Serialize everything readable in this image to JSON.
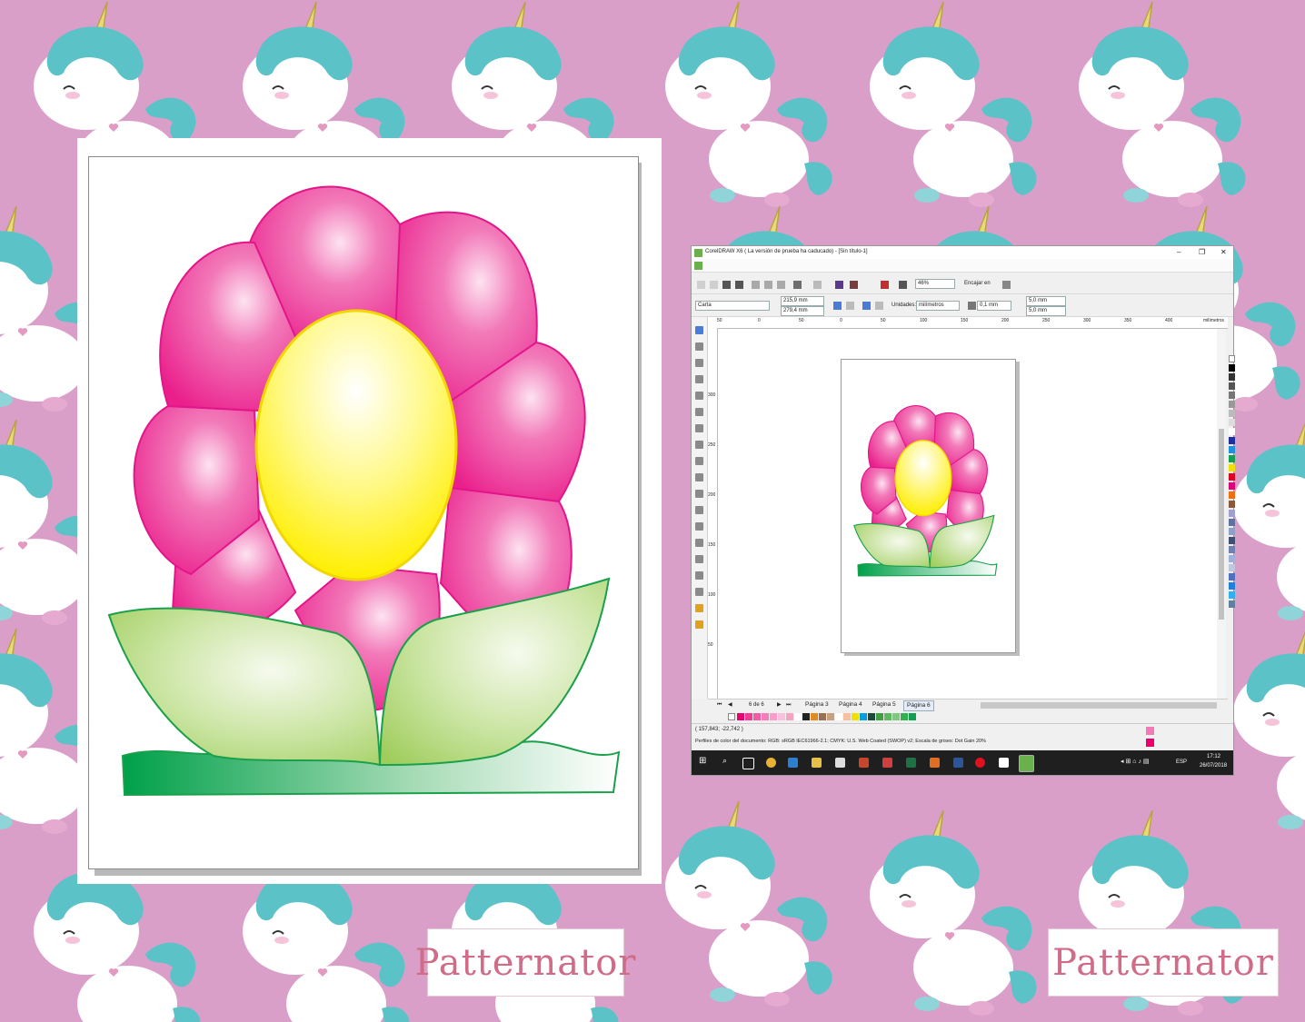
{
  "watermark_text": "Patternator",
  "colors": {
    "background": "#d99fc9",
    "petal_pink": "#ee3a9b",
    "center_yellow": "#fff02a",
    "leaf_green": "#a6d36b",
    "grass_green": "#0aa24a",
    "taskbar": "#1f1f1f"
  },
  "window": {
    "title": "CorelDRAW X6 ( La versión de prueba ha caducado) - [Sin título-1]",
    "controls": {
      "minimize": "–",
      "restore": "❐",
      "close": "✕"
    },
    "toolbar": {
      "zoom_value": "46%",
      "snap_label": "Encajar en"
    },
    "property_bar": {
      "page_size": "Carta",
      "width": "215,9 mm",
      "height": "279,4 mm",
      "units_label": "Unidades:",
      "units_value": "milímetros",
      "nudge": "0,1 mm",
      "dup_x": "5,0 mm",
      "dup_y": "5,0 mm"
    },
    "ruler": {
      "ticks": [
        "50",
        "0",
        "50",
        "100",
        "150",
        "200",
        "250",
        "300",
        "350",
        "400"
      ],
      "unit": "milímetros",
      "vticks": [
        "300",
        "250",
        "200",
        "150",
        "100",
        "50"
      ]
    },
    "pages": {
      "counter": "6 de 6",
      "tabs": [
        "Página 3",
        "Página 4",
        "Página 5",
        "Página 6"
      ],
      "active_index": 3
    },
    "status": {
      "coords": "( 157,843; -22,742 )",
      "color_profile": "Perfiles de color del documento: RGB: sRGB IEC61966-2.1; CMYK: U.S. Web Coated (SWOP) v2; Escala de grises: Dot Gain 20%"
    },
    "taskbar": {
      "language": "ESP",
      "time": "17:12",
      "date": "26/07/2018"
    }
  }
}
